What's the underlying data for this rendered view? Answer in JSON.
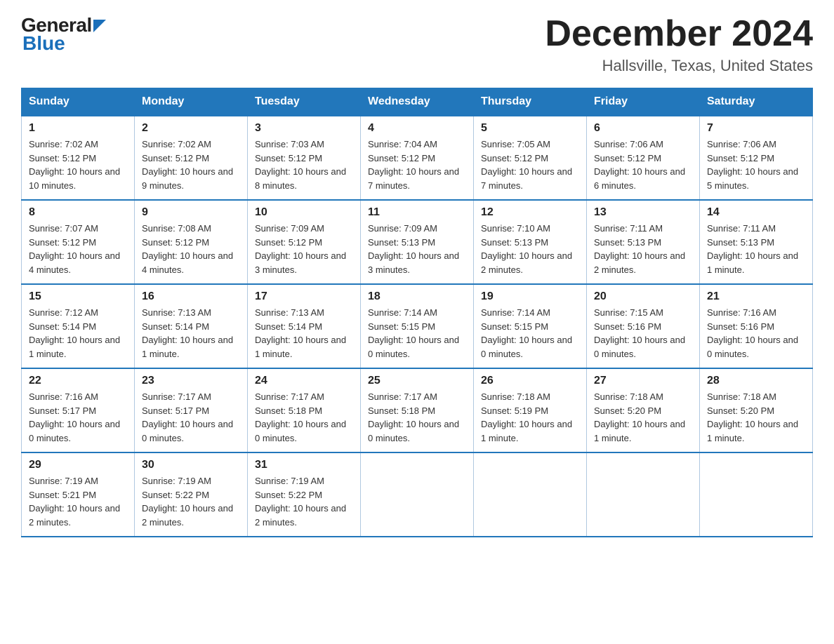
{
  "header": {
    "logo_general": "General",
    "logo_blue": "Blue",
    "month_title": "December 2024",
    "location": "Hallsville, Texas, United States"
  },
  "days_of_week": [
    "Sunday",
    "Monday",
    "Tuesday",
    "Wednesday",
    "Thursday",
    "Friday",
    "Saturday"
  ],
  "weeks": [
    [
      {
        "day": "1",
        "sunrise": "7:02 AM",
        "sunset": "5:12 PM",
        "daylight": "10 hours and 10 minutes."
      },
      {
        "day": "2",
        "sunrise": "7:02 AM",
        "sunset": "5:12 PM",
        "daylight": "10 hours and 9 minutes."
      },
      {
        "day": "3",
        "sunrise": "7:03 AM",
        "sunset": "5:12 PM",
        "daylight": "10 hours and 8 minutes."
      },
      {
        "day": "4",
        "sunrise": "7:04 AM",
        "sunset": "5:12 PM",
        "daylight": "10 hours and 7 minutes."
      },
      {
        "day": "5",
        "sunrise": "7:05 AM",
        "sunset": "5:12 PM",
        "daylight": "10 hours and 7 minutes."
      },
      {
        "day": "6",
        "sunrise": "7:06 AM",
        "sunset": "5:12 PM",
        "daylight": "10 hours and 6 minutes."
      },
      {
        "day": "7",
        "sunrise": "7:06 AM",
        "sunset": "5:12 PM",
        "daylight": "10 hours and 5 minutes."
      }
    ],
    [
      {
        "day": "8",
        "sunrise": "7:07 AM",
        "sunset": "5:12 PM",
        "daylight": "10 hours and 4 minutes."
      },
      {
        "day": "9",
        "sunrise": "7:08 AM",
        "sunset": "5:12 PM",
        "daylight": "10 hours and 4 minutes."
      },
      {
        "day": "10",
        "sunrise": "7:09 AM",
        "sunset": "5:12 PM",
        "daylight": "10 hours and 3 minutes."
      },
      {
        "day": "11",
        "sunrise": "7:09 AM",
        "sunset": "5:13 PM",
        "daylight": "10 hours and 3 minutes."
      },
      {
        "day": "12",
        "sunrise": "7:10 AM",
        "sunset": "5:13 PM",
        "daylight": "10 hours and 2 minutes."
      },
      {
        "day": "13",
        "sunrise": "7:11 AM",
        "sunset": "5:13 PM",
        "daylight": "10 hours and 2 minutes."
      },
      {
        "day": "14",
        "sunrise": "7:11 AM",
        "sunset": "5:13 PM",
        "daylight": "10 hours and 1 minute."
      }
    ],
    [
      {
        "day": "15",
        "sunrise": "7:12 AM",
        "sunset": "5:14 PM",
        "daylight": "10 hours and 1 minute."
      },
      {
        "day": "16",
        "sunrise": "7:13 AM",
        "sunset": "5:14 PM",
        "daylight": "10 hours and 1 minute."
      },
      {
        "day": "17",
        "sunrise": "7:13 AM",
        "sunset": "5:14 PM",
        "daylight": "10 hours and 1 minute."
      },
      {
        "day": "18",
        "sunrise": "7:14 AM",
        "sunset": "5:15 PM",
        "daylight": "10 hours and 0 minutes."
      },
      {
        "day": "19",
        "sunrise": "7:14 AM",
        "sunset": "5:15 PM",
        "daylight": "10 hours and 0 minutes."
      },
      {
        "day": "20",
        "sunrise": "7:15 AM",
        "sunset": "5:16 PM",
        "daylight": "10 hours and 0 minutes."
      },
      {
        "day": "21",
        "sunrise": "7:16 AM",
        "sunset": "5:16 PM",
        "daylight": "10 hours and 0 minutes."
      }
    ],
    [
      {
        "day": "22",
        "sunrise": "7:16 AM",
        "sunset": "5:17 PM",
        "daylight": "10 hours and 0 minutes."
      },
      {
        "day": "23",
        "sunrise": "7:17 AM",
        "sunset": "5:17 PM",
        "daylight": "10 hours and 0 minutes."
      },
      {
        "day": "24",
        "sunrise": "7:17 AM",
        "sunset": "5:18 PM",
        "daylight": "10 hours and 0 minutes."
      },
      {
        "day": "25",
        "sunrise": "7:17 AM",
        "sunset": "5:18 PM",
        "daylight": "10 hours and 0 minutes."
      },
      {
        "day": "26",
        "sunrise": "7:18 AM",
        "sunset": "5:19 PM",
        "daylight": "10 hours and 1 minute."
      },
      {
        "day": "27",
        "sunrise": "7:18 AM",
        "sunset": "5:20 PM",
        "daylight": "10 hours and 1 minute."
      },
      {
        "day": "28",
        "sunrise": "7:18 AM",
        "sunset": "5:20 PM",
        "daylight": "10 hours and 1 minute."
      }
    ],
    [
      {
        "day": "29",
        "sunrise": "7:19 AM",
        "sunset": "5:21 PM",
        "daylight": "10 hours and 2 minutes."
      },
      {
        "day": "30",
        "sunrise": "7:19 AM",
        "sunset": "5:22 PM",
        "daylight": "10 hours and 2 minutes."
      },
      {
        "day": "31",
        "sunrise": "7:19 AM",
        "sunset": "5:22 PM",
        "daylight": "10 hours and 2 minutes."
      },
      null,
      null,
      null,
      null
    ]
  ]
}
